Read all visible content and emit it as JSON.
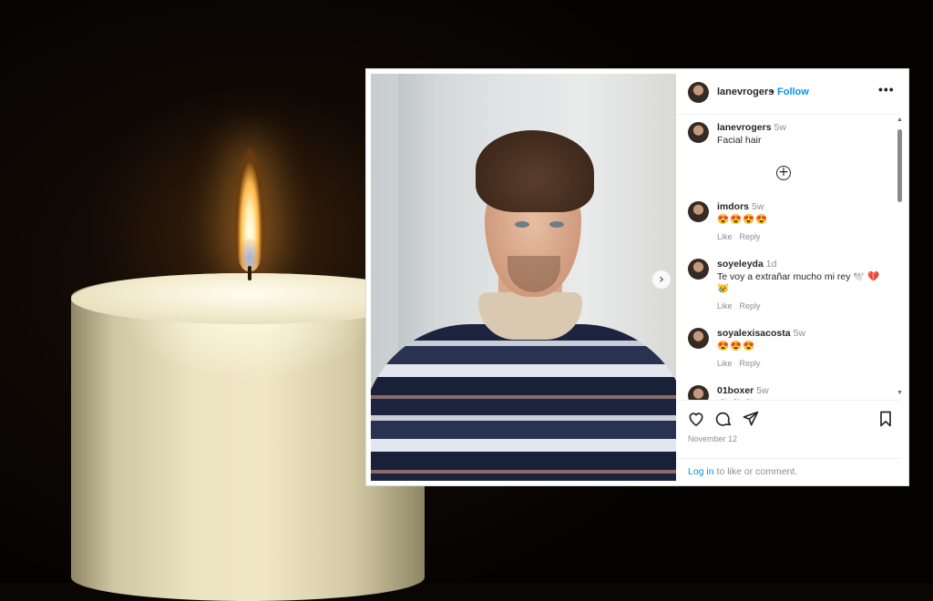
{
  "post": {
    "username": "lanevrogers",
    "separator": "•",
    "follow_label": "Follow",
    "more_label": "•••",
    "caption": {
      "user": "lanevrogers",
      "time": "5w",
      "text": "Facial hair"
    },
    "comments": [
      {
        "user": "imdors",
        "time": "5w",
        "text": "😍😍😍😍",
        "like": "Like",
        "reply": "Reply"
      },
      {
        "user": "soyeleyda",
        "time": "1d",
        "text": "Te voy a extrañar mucho mi rey 🕊️ 💔 😿",
        "like": "Like",
        "reply": "Reply"
      },
      {
        "user": "soyalexisacosta",
        "time": "5w",
        "text": "😍😍😍",
        "like": "Like",
        "reply": "Reply"
      },
      {
        "user": "01boxer",
        "time": "5w",
        "text": "👏👏👏",
        "like": "",
        "reply": ""
      }
    ],
    "date": "November 12",
    "login_link": "Log in",
    "login_text": " to like or comment."
  },
  "icons": {
    "add_comments": "plus-circle-icon",
    "next_photo": "chevron-right-icon",
    "heart": "heart-icon",
    "comment": "comment-icon",
    "share": "share-icon",
    "save": "bookmark-icon"
  },
  "colors": {
    "link": "#0095f6",
    "text": "#262626",
    "muted": "#8e8e8e"
  }
}
